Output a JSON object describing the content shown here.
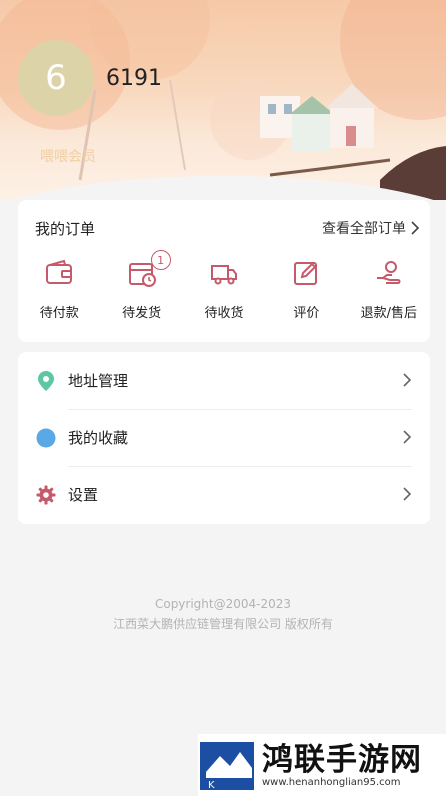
{
  "profile": {
    "avatar_text": "6",
    "username": "6191",
    "member_label": "喂喂会员"
  },
  "orders": {
    "title": "我的订单",
    "view_all": "查看全部订单",
    "items": [
      {
        "label": "待付款",
        "icon": "wallet-icon"
      },
      {
        "label": "待发货",
        "icon": "box-clock-icon",
        "badge": "1"
      },
      {
        "label": "待收货",
        "icon": "truck-icon"
      },
      {
        "label": "评价",
        "icon": "edit-icon"
      },
      {
        "label": "退款/售后",
        "icon": "refund-hand-icon"
      }
    ]
  },
  "menu": {
    "items": [
      {
        "label": "地址管理",
        "icon": "location-pin-icon"
      },
      {
        "label": "我的收藏",
        "icon": "favorite-dot-icon"
      },
      {
        "label": "设置",
        "icon": "gear-icon"
      }
    ]
  },
  "footer": {
    "copyright": "Copyright@2004-2023",
    "company": "江西菜大鹏供应链管理有限公司 版权所有"
  },
  "watermark": {
    "title": "鸿联手游网",
    "url": "www.henanhonglian95.com"
  },
  "colors": {
    "accent": "#c45a6a",
    "pin": "#5cc7a0",
    "favorite": "#5aa9e6",
    "gear": "#c45a6a"
  }
}
